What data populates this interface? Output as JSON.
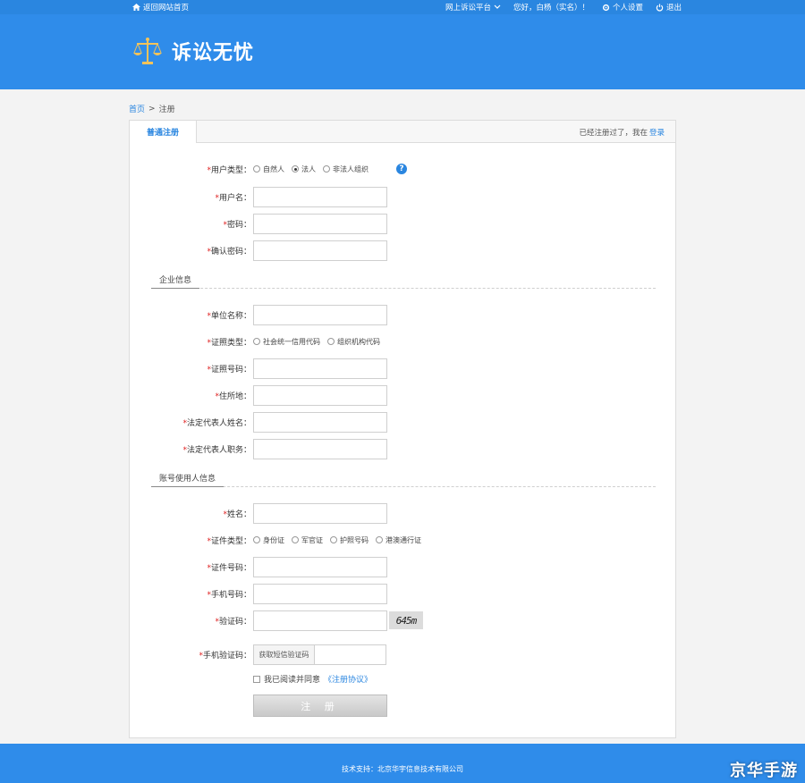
{
  "topbar": {
    "home_link": "返回网站首页",
    "platform": "网上诉讼平台",
    "greeting": "您好，白杨（实名）！",
    "settings": "个人设置",
    "logout": "退出"
  },
  "header": {
    "logo_text": "诉讼无忧"
  },
  "breadcrumb": {
    "home": "首页",
    "separator": ">",
    "current": "注册"
  },
  "panel": {
    "tab": "普通注册",
    "already_text": "已经注册过了，我在",
    "login": "登录"
  },
  "form": {
    "required_mark": "*",
    "user_type": {
      "label": "用户类型：",
      "options": [
        "自然人",
        "法人",
        "非法人组织"
      ],
      "selected": "法人"
    },
    "username": {
      "label": "用户名："
    },
    "password": {
      "label": "密码："
    },
    "confirm_password": {
      "label": "确认密码："
    },
    "section_company": "企业信息",
    "company_name": {
      "label": "单位名称："
    },
    "license_type": {
      "label": "证照类型：",
      "options": [
        "社会统一信用代码",
        "组织机构代码"
      ]
    },
    "license_no": {
      "label": "证照号码："
    },
    "address": {
      "label": "住所地："
    },
    "legal_rep_name": {
      "label": "法定代表人姓名："
    },
    "legal_rep_title": {
      "label": "法定代表人职务："
    },
    "section_user": "账号使用人信息",
    "name": {
      "label": "姓名："
    },
    "id_type": {
      "label": "证件类型：",
      "options": [
        "身份证",
        "军官证",
        "护照号码",
        "港澳通行证"
      ]
    },
    "id_no": {
      "label": "证件号码："
    },
    "phone": {
      "label": "手机号码："
    },
    "captcha": {
      "label": "验证码：",
      "image_text": "645m"
    },
    "sms_code": {
      "label": "手机验证码：",
      "button": "获取短信验证码"
    },
    "agree_text": "我已阅读并同意",
    "agreement_link": "《注册协议》",
    "submit": "注 册"
  },
  "footer": {
    "text": "技术支持：北京华宇信息技术有限公司"
  },
  "watermark": "京华手游",
  "colors": {
    "primary": "#2f8cea",
    "topbar": "#2a86e0",
    "required": "#e02020",
    "link": "#2a86e0"
  }
}
